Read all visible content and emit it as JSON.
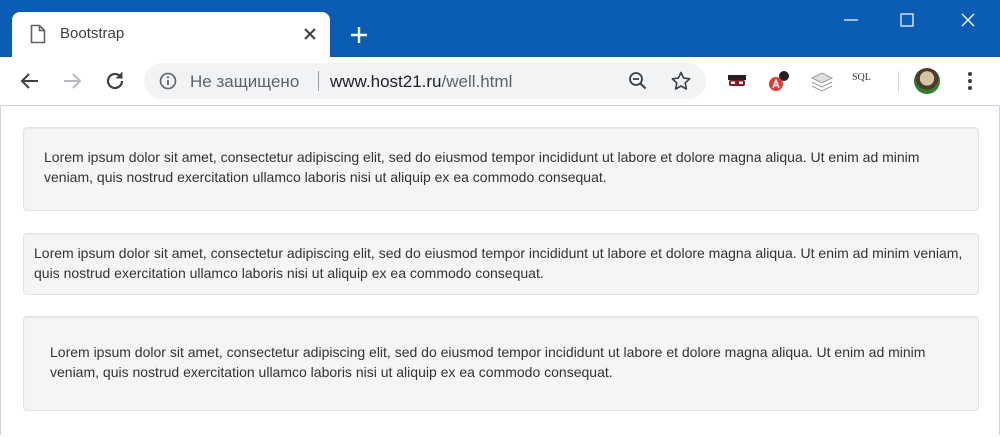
{
  "browser": {
    "tab_title": "Bootstrap",
    "security_label": "Не защищено",
    "url_host": "www.host21.ru",
    "url_path": "/well.html",
    "extensions": {
      "sql_label": "SQL"
    },
    "icons": [
      "document-icon",
      "close-icon",
      "new-tab-icon",
      "minimize-icon",
      "maximize-icon",
      "window-close-icon",
      "back-arrow-icon",
      "forward-arrow-icon",
      "reload-icon",
      "info-icon",
      "zoom-out-icon",
      "star-icon",
      "incognito-mask-icon",
      "translate-icon",
      "layers-icon",
      "avatar",
      "more-menu-icon"
    ],
    "colors": {
      "titlebar": "#0b5cb5",
      "well_background": "#f5f5f5",
      "well_border": "#e3e3e3"
    }
  },
  "page": {
    "wells": [
      {
        "size": "default",
        "text": "Lorem ipsum dolor sit amet, consectetur adipiscing elit, sed do eiusmod tempor incididunt ut labore et dolore magna aliqua. Ut enim ad minim veniam, quis nostrud exercitation ullamco laboris nisi ut aliquip ex ea commodo consequat."
      },
      {
        "size": "small",
        "text": "Lorem ipsum dolor sit amet, consectetur adipiscing elit, sed do eiusmod tempor incididunt ut labore et dolore magna aliqua. Ut enim ad minim veniam, quis nostrud exercitation ullamco laboris nisi ut aliquip ex ea commodo consequat."
      },
      {
        "size": "large",
        "text": "Lorem ipsum dolor sit amet, consectetur adipiscing elit, sed do eiusmod tempor incididunt ut labore et dolore magna aliqua. Ut enim ad minim veniam, quis nostrud exercitation ullamco laboris nisi ut aliquip ex ea commodo consequat."
      }
    ]
  }
}
